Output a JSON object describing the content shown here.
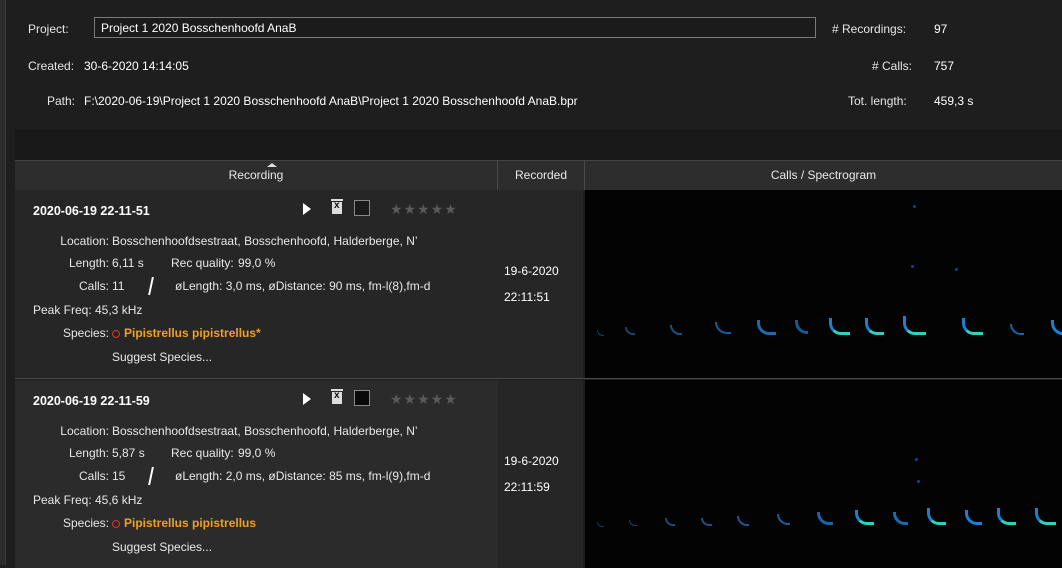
{
  "header": {
    "project_label": "Project:",
    "project_value": "Project 1 2020 Bosschenhoofd AnaB",
    "created_label": "Created:",
    "created_value": "30-6-2020 14:14:05",
    "path_label": "Path:",
    "path_value": "F:\\2020-06-19\\Project 1 2020 Bosschenhoofd AnaB\\Project 1 2020 Bosschenhoofd AnaB.bpr",
    "recordings_label": "# Recordings:",
    "recordings_value": "97",
    "calls_label": "# Calls:",
    "calls_value": "757",
    "totlen_label": "Tot. length:",
    "totlen_value": "459,3 s"
  },
  "table": {
    "columns": [
      "Recording",
      "Recorded",
      "Calls / Spectrogram"
    ],
    "rows": [
      {
        "title": "2020-06-19 22-11-51",
        "location_label": "Location:",
        "location": "Bosschenhoofdsestraat, Bosschenhoofd, Halderberge, N’",
        "length_label": "Length:",
        "length": "6,11 s",
        "quality_label": "Rec quality:",
        "quality": "99,0 %",
        "calls_label": "Calls:",
        "calls": "11",
        "calls_detail": "øLength: 3,0 ms, øDistance: 90 ms, fm-l(8),fm-d",
        "peak_label": "Peak Freq:",
        "peak": "45,3 kHz",
        "species_label": "Species:",
        "species": "Pipistrellus pipistrellus*",
        "suggest": "Suggest Species...",
        "rec_date": "19-6-2020",
        "rec_time": "22:11:51",
        "stars": "★★★★★"
      },
      {
        "title": "2020-06-19 22-11-59",
        "location_label": "Location:",
        "location": "Bosschenhoofdsestraat, Bosschenhoofd, Halderberge, N’",
        "length_label": "Length:",
        "length": "5,87 s",
        "quality_label": "Rec quality:",
        "quality": "99,0 %",
        "calls_label": "Calls:",
        "calls": "15",
        "calls_detail": "øLength: 2,0 ms, øDistance: 85 ms, fm-l(9),fm-d",
        "peak_label": "Peak Freq:",
        "peak": "45,6 kHz",
        "species_label": "Species:",
        "species": "Pipistrellus pipistrellus",
        "suggest": "Suggest Species...",
        "rec_date": "19-6-2020",
        "rec_time": "22:11:59",
        "stars": "★★★★★"
      }
    ]
  },
  "icons": {
    "play": "play-icon",
    "delete": "trash-icon",
    "checkbox": "checkbox",
    "rating": "star-rating"
  },
  "colors": {
    "species": "#f0a020",
    "species_marker": "#e03030",
    "spectrogram_call": "#1c7fd0"
  }
}
